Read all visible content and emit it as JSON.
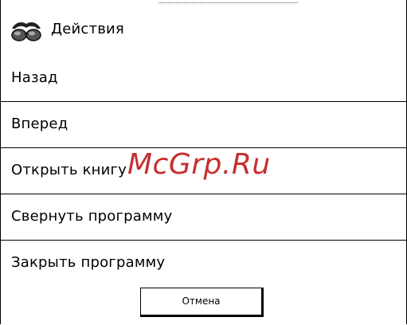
{
  "dialog": {
    "title": "Действия",
    "icon": "glasses-icon"
  },
  "menu": {
    "items": [
      {
        "label": "Назад"
      },
      {
        "label": "Вперед"
      },
      {
        "label": "Открыть книгу"
      },
      {
        "label": "Свернуть программу"
      },
      {
        "label": "Закрыть программу"
      }
    ]
  },
  "footer": {
    "cancel_label": "Отмена"
  },
  "watermark": {
    "text": "McGrp.Ru",
    "color": "#c62f2f"
  }
}
